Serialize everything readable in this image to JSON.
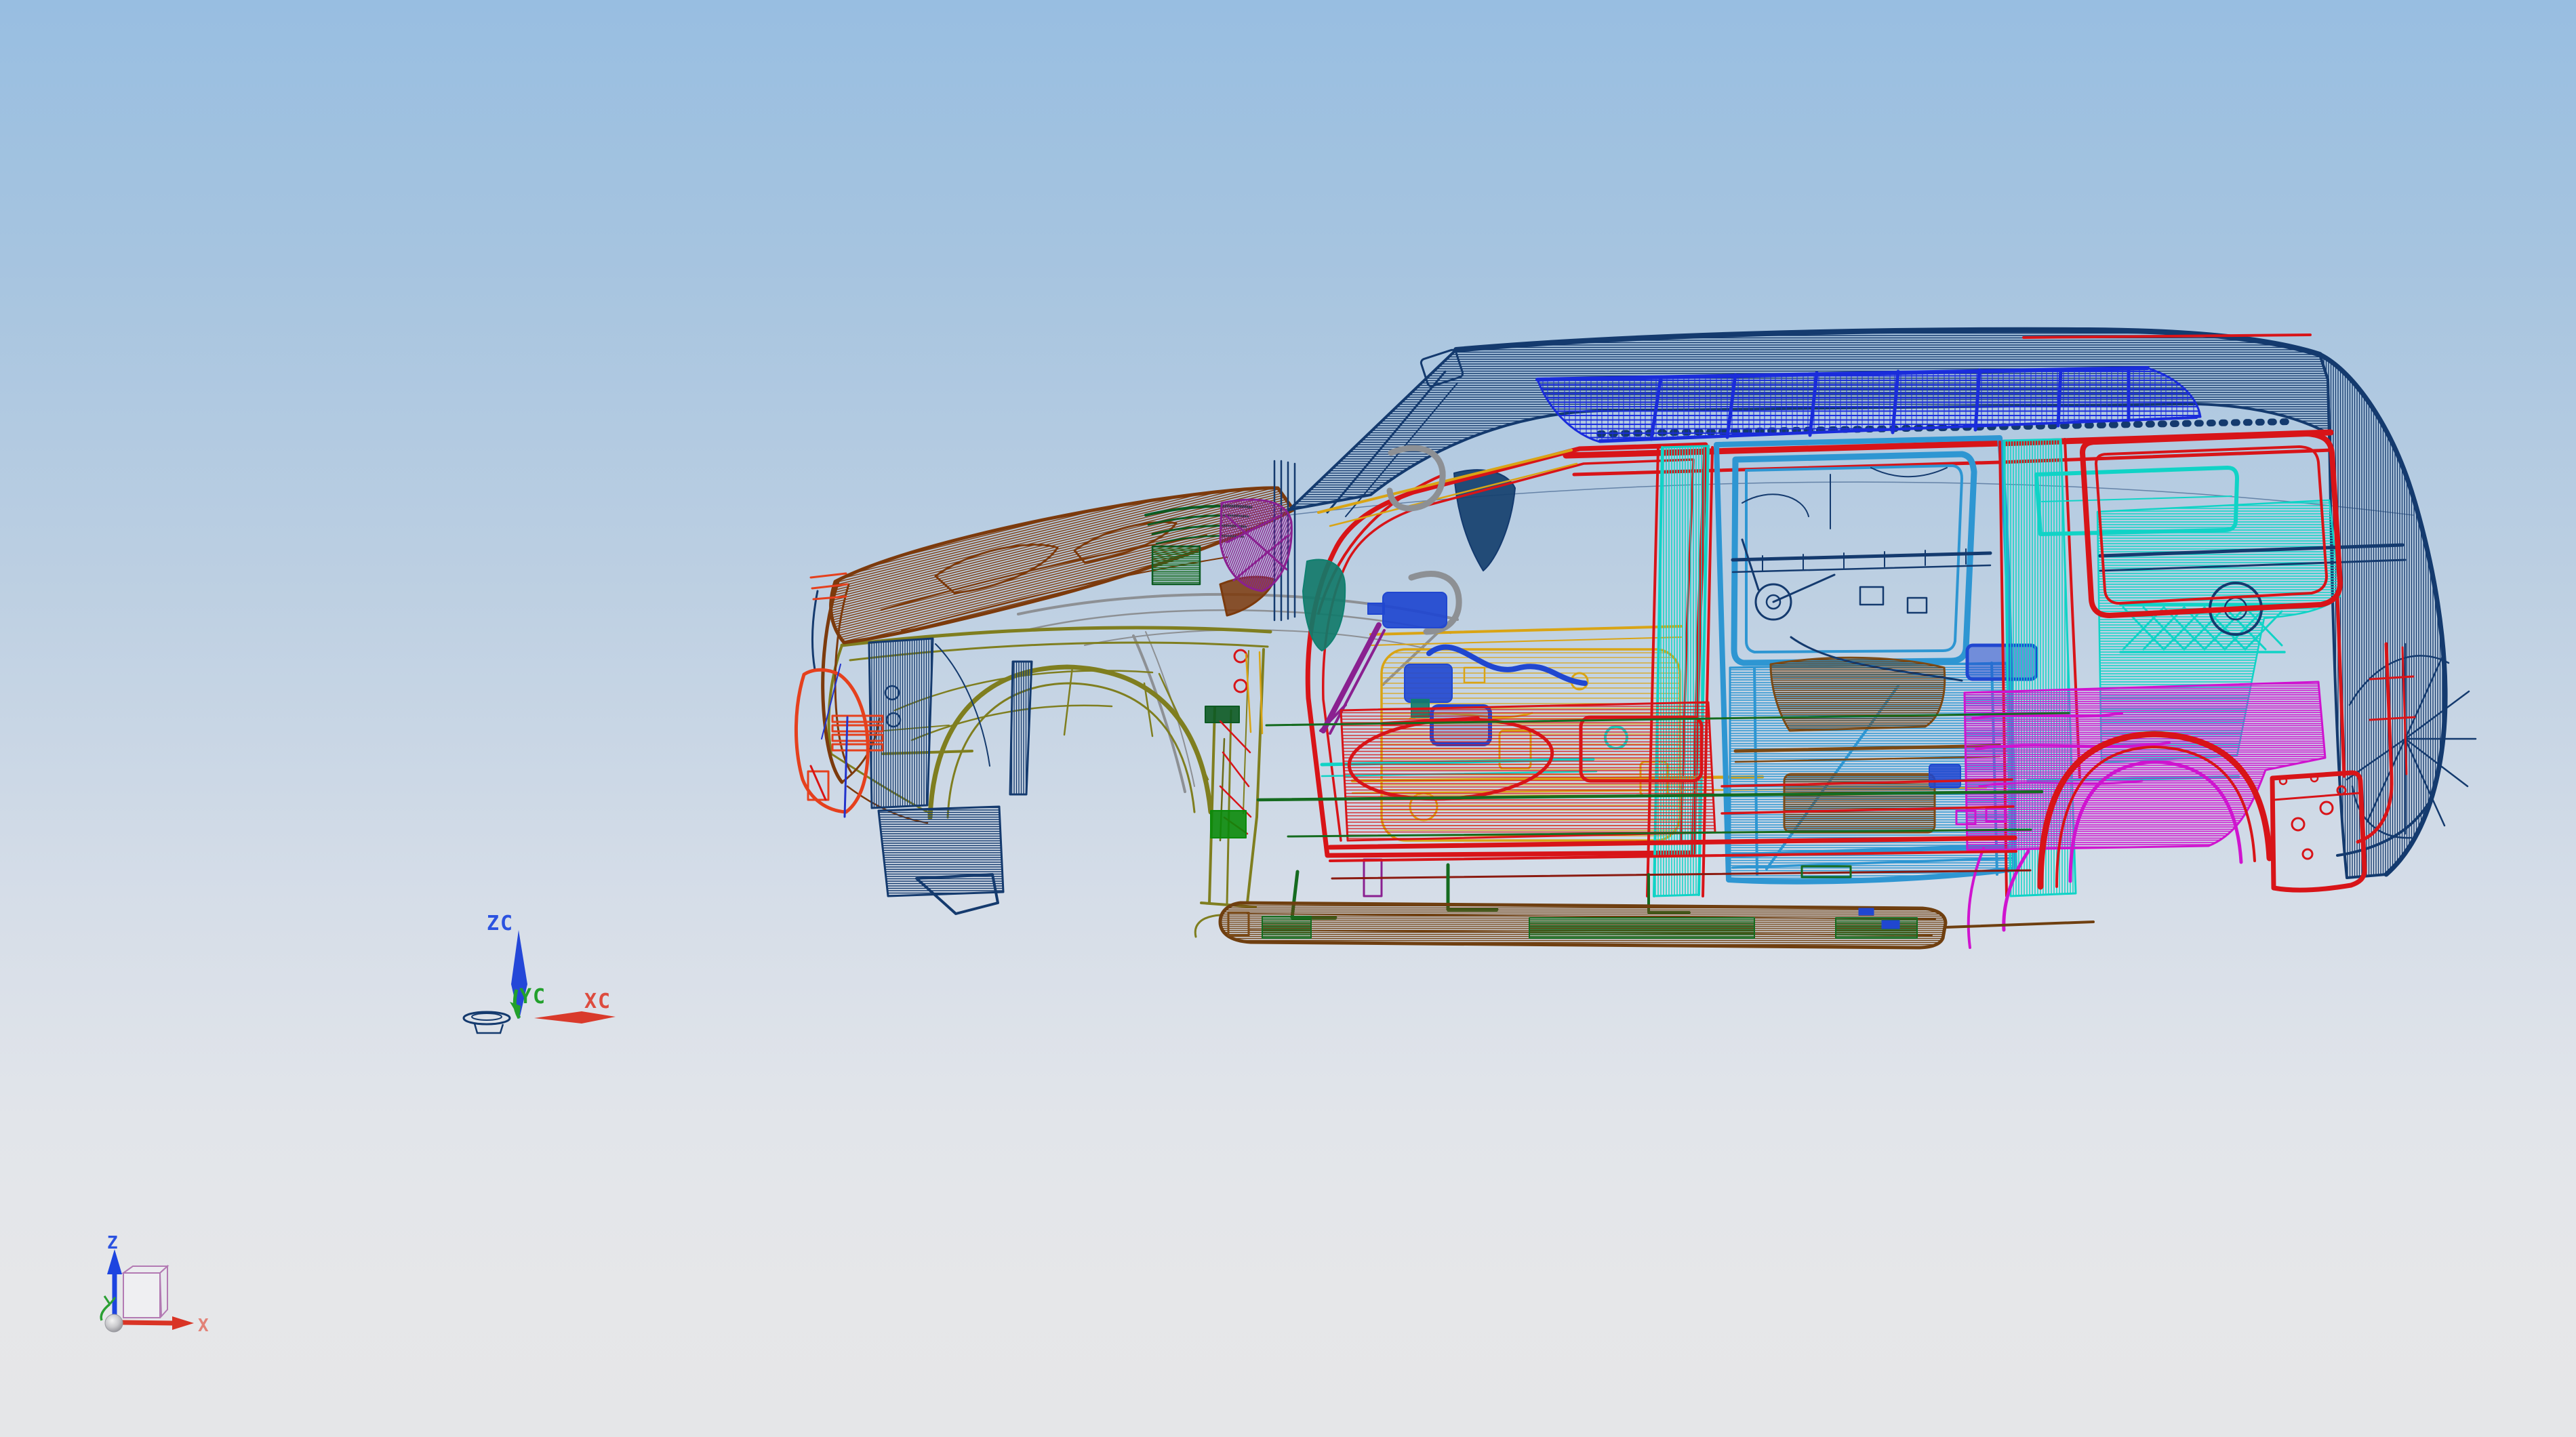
{
  "viewport": {
    "background_top": "#98bee1",
    "background_bottom": "#e5e6e8",
    "type": "cad-3d-viewport"
  },
  "wcs_triad": {
    "zc_label": "ZC",
    "yc_label": "YC",
    "xc_label": "XC",
    "z_axis_color": "#2b52e0",
    "y_axis_color": "#22a02c",
    "x_axis_color": "#d93a2b"
  },
  "view_triad": {
    "z_label": "Z",
    "x_label": "X",
    "z_axis_color": "#1d44e0",
    "x_axis_color": "#d93425",
    "y_axis_color": "#2ba033",
    "cube_edge_color": "#b37ab3"
  },
  "model": {
    "parts": [
      {
        "name": "hood",
        "color": "#7c3a0c"
      },
      {
        "name": "front-fender",
        "color": "#7f7e1f"
      },
      {
        "name": "radiator-support",
        "color": "#143a6e"
      },
      {
        "name": "front-end-carrier",
        "color": "#e5401d"
      },
      {
        "name": "roof-outer-structure",
        "color": "#143a6e"
      },
      {
        "name": "roof-inner-panel",
        "color": "#1a2cdb"
      },
      {
        "name": "door-opening-frames",
        "color": "#d81418"
      },
      {
        "name": "front-door-inner",
        "color": "#d9a414"
      },
      {
        "name": "b-pillar",
        "color": "#10d3c6"
      },
      {
        "name": "rear-door",
        "color": "#2e96d2"
      },
      {
        "name": "rear-door-inner",
        "color": "#7b4a16"
      },
      {
        "name": "quarter-panel-inner",
        "color": "#10d3c6"
      },
      {
        "name": "rear-wheelhouse",
        "color": "#cf14cf"
      },
      {
        "name": "floor-structure",
        "color": "#d81418"
      },
      {
        "name": "floor-crossmembers",
        "color": "#156b1f"
      },
      {
        "name": "running-board",
        "color": "#6f3f10"
      },
      {
        "name": "cowl-trim",
        "color": "#8a2090"
      },
      {
        "name": "door-handles",
        "color": "#8d9094"
      }
    ]
  }
}
